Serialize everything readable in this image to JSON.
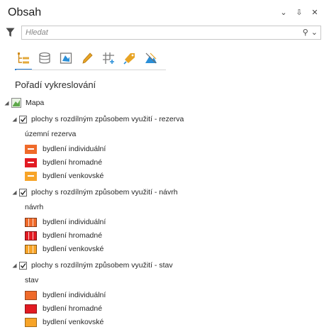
{
  "pane": {
    "title": "Obsah",
    "controls": [
      "⌄",
      "⇩",
      "✕"
    ]
  },
  "search": {
    "placeholder": "Hledat",
    "buttons": [
      "⚲",
      "⌄"
    ]
  },
  "toolbar": {
    "tools": [
      "list-by-drawing-order",
      "list-by-source",
      "list-by-selection",
      "list-by-editing",
      "list-by-snapping",
      "list-by-labeling",
      "list-by-perspective-imagery"
    ]
  },
  "heading": "Pořadí vykreslování",
  "map": {
    "label": "Mapa"
  },
  "layers": [
    {
      "label": "plochy s rozdílným způsobem využití - rezerva",
      "checked": true,
      "group_heading": "územní rezerva",
      "legend": [
        {
          "label": "bydlení individuální",
          "color": "#ef6a2a",
          "style": "bar"
        },
        {
          "label": "bydlení hromadné",
          "color": "#e21b23",
          "style": "bar"
        },
        {
          "label": "bydlení venkovské",
          "color": "#f7a428",
          "style": "bar"
        }
      ]
    },
    {
      "label": "plochy s rozdílným způsobem využití - návrh",
      "checked": true,
      "group_heading": "návrh",
      "legend": [
        {
          "label": "bydlení individuální",
          "color": "#ef6a2a",
          "style": "hatched"
        },
        {
          "label": "bydlení hromadné",
          "color": "#e21b23",
          "style": "hatched"
        },
        {
          "label": "bydlení venkovské",
          "color": "#f7a428",
          "style": "hatched"
        }
      ]
    },
    {
      "label": "plochy s rozdílným způsobem využití - stav",
      "checked": true,
      "group_heading": "stav",
      "legend": [
        {
          "label": "bydlení individuální",
          "color": "#ef6a2a",
          "style": "plain"
        },
        {
          "label": "bydlení hromadné",
          "color": "#e21b23",
          "style": "plain"
        },
        {
          "label": "bydlení venkovské",
          "color": "#f7a428",
          "style": "plain"
        }
      ]
    }
  ],
  "accent": "#2a7fd4"
}
